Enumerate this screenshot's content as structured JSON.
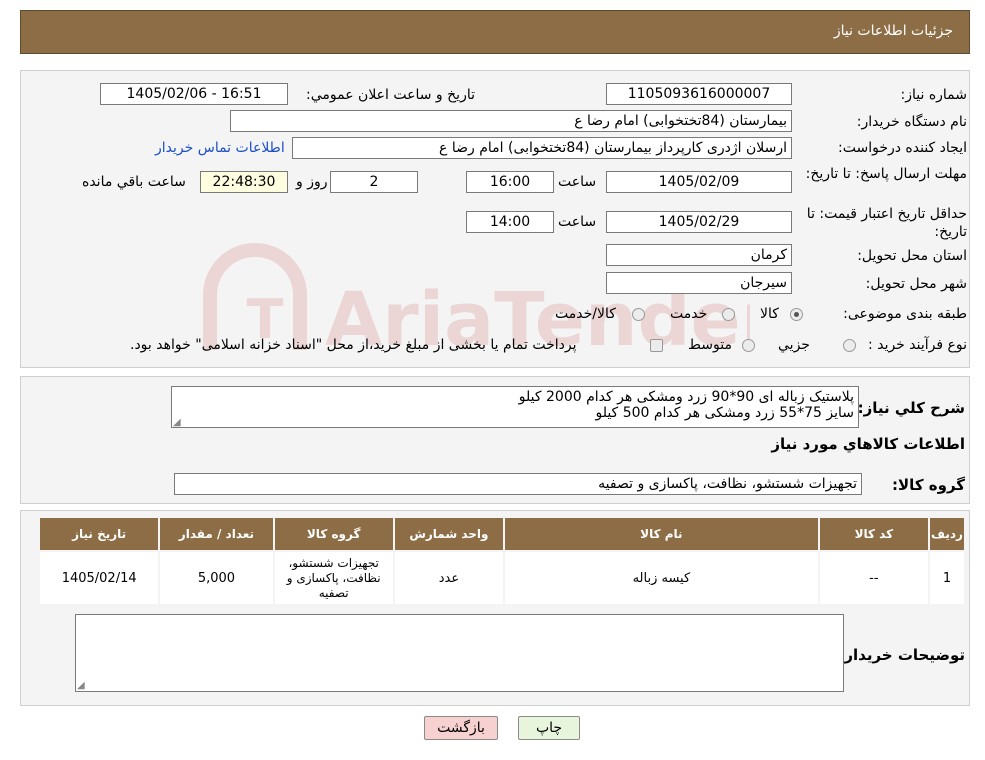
{
  "header": {
    "title": "جزئیات اطلاعات نیاز"
  },
  "form": {
    "need_number_label": "شماره نیاز:",
    "need_number": "1105093616000007",
    "announce_label": "تاریخ و ساعت اعلان عمومي:",
    "announce_value": "1405/02/06 - 16:51",
    "buyer_org_label": "نام دستگاه خریدار:",
    "buyer_org": "بیمارستان (84تختخوابی) امام رضا  ع",
    "requester_label": "ایجاد کننده درخواست:",
    "requester": "ارسلان اژدری کارپرداز بیمارستان (84تختخوابی) امام رضا  ع",
    "contact_link": "اطلاعات تماس خریدار",
    "deadline_label": "مهلت ارسال پاسخ: تا تاریخ:",
    "deadline_date": "1405/02/09",
    "time_label": "ساعت",
    "deadline_time": "16:00",
    "days": "2",
    "days_label": "روز و",
    "remaining": "22:48:30",
    "remaining_label": "ساعت باقي مانده",
    "validity_label": "حداقل تاریخ اعتبار قیمت: تا تاریخ:",
    "validity_date": "1405/02/29",
    "validity_time": "14:00",
    "province_label": "استان محل تحویل:",
    "province": "کرمان",
    "city_label": "شهر محل تحویل:",
    "city": "سیرجان",
    "category_label": "طبقه بندی موضوعی:",
    "category_options": [
      "کالا",
      "خدمت",
      "کالا/خدمت"
    ],
    "category_selected": "کالا",
    "process_label": "نوع فرآیند خرید :",
    "process_options": [
      "جزيي",
      "متوسط"
    ],
    "process_note": "پرداخت تمام یا بخشی از مبلغ خرید،از محل \"اسناد خزانه اسلامی\" خواهد بود."
  },
  "description": {
    "label": "شرح كلي نياز:",
    "line1": "پلاستیک زباله ای  90*90 زرد ومشکی هر کدام 2000 کیلو",
    "line2": "سایز 75*55 زرد ومشکی هر کدام 500 کیلو"
  },
  "goods": {
    "section_title": "اطلاعات کالاهاي مورد نياز",
    "group_label": "گروه کالا:",
    "group_value": "تجهیزات شستشو، نظافت، پاکسازی و تصفیه",
    "columns": [
      "رديف",
      "کد کالا",
      "نام کالا",
      "واحد شمارش",
      "گروه کالا",
      "تعداد / مقدار",
      "تاریخ نیاز"
    ],
    "rows": [
      {
        "row": "1",
        "code": "--",
        "name": "کیسه زباله",
        "unit": "عدد",
        "group": "تجهیزات شستشو، نظافت، پاکسازی و تصفیه",
        "qty": "5,000",
        "date": "1405/02/14"
      }
    ]
  },
  "buyer_notes": {
    "label": "توضیحات خریدار:",
    "value": ""
  },
  "buttons": {
    "print": "چاپ",
    "back": "بازگشت"
  },
  "watermark": {
    "text": "AriaTender.neT"
  },
  "colors": {
    "header_bg": "#8c6d45",
    "link": "#1a4fc9",
    "back_button_bg": "#f7d0d0",
    "print_button_bg": "#e6f5dc"
  }
}
